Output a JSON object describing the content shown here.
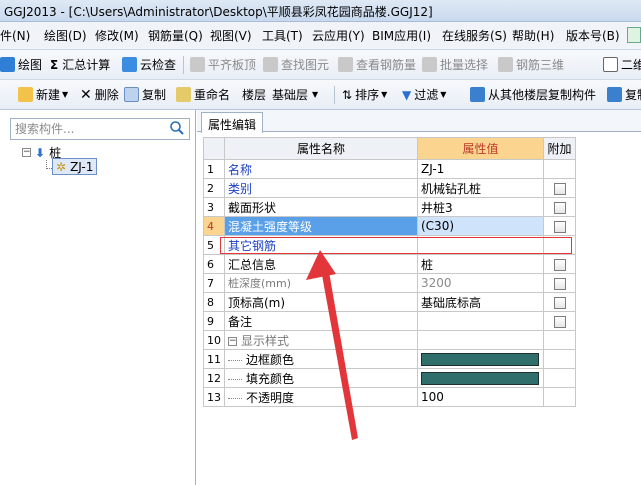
{
  "window": {
    "title": "GGJ2013 - [C:\\Users\\Administrator\\Desktop\\平顺县彩凤花园商品楼.GGJ12]"
  },
  "menu": [
    {
      "label": "件(N)"
    },
    {
      "label": "绘图(D)"
    },
    {
      "label": "修改(M)"
    },
    {
      "label": "钢筋量(Q)"
    },
    {
      "label": "视图(V)"
    },
    {
      "label": "工具(T)"
    },
    {
      "label": "云应用(Y)"
    },
    {
      "label": "BIM应用(I)"
    },
    {
      "label": "在线服务(S)"
    },
    {
      "label": "帮助(H)"
    },
    {
      "label": "版本号(B)"
    }
  ],
  "toolbar1": {
    "draw": "绘图",
    "summary": "汇总计算",
    "cloud_check": "云检查",
    "flat_slab": "平齐板顶",
    "find_element": "查找图元",
    "view_rebar": "查看钢筋量",
    "batch_select": "批量选择",
    "rebar_3d": "钢筋三维",
    "two_d": "二维"
  },
  "toolbar2": {
    "new": "新建",
    "delete": "删除",
    "copy": "复制",
    "rename": "重命名",
    "floor_label": "楼层",
    "floor_value": "基础层",
    "sort": "排序",
    "filter": "过滤",
    "copy_from_floor": "从其他楼层复制构件",
    "copy2": "复制"
  },
  "left_panel": {
    "search_placeholder": "搜索构件...",
    "tree_root": "桩",
    "tree_child": "ZJ-1"
  },
  "tab": "属性编辑",
  "grid": {
    "headers": {
      "name": "属性名称",
      "value": "属性值",
      "extra": "附加"
    },
    "rows": [
      {
        "num": "1",
        "name": "名称",
        "value": "ZJ-1",
        "checkbox": false
      },
      {
        "num": "2",
        "name": "类别",
        "value": "机械钻孔桩",
        "checkbox": true
      },
      {
        "num": "3",
        "name": "截面形状",
        "value": "井桩3",
        "checkbox": true
      },
      {
        "num": "4",
        "name": "混凝土强度等级",
        "value": "(C30)",
        "checkbox": true
      },
      {
        "num": "5",
        "name": "其它钢筋",
        "value": "",
        "checkbox": false
      },
      {
        "num": "6",
        "name": "汇总信息",
        "value": "桩",
        "checkbox": true
      },
      {
        "num": "7",
        "name": "桩深度(mm)",
        "value": "3200",
        "checkbox": true
      },
      {
        "num": "8",
        "name": "顶标高(m)",
        "value": "基础底标高",
        "checkbox": true
      },
      {
        "num": "9",
        "name": "备注",
        "value": "",
        "checkbox": true
      },
      {
        "num": "10",
        "name": "显示样式",
        "value": "",
        "checkbox": false
      },
      {
        "num": "11",
        "name": "边框颜色",
        "value": "",
        "checkbox": false
      },
      {
        "num": "12",
        "name": "填充颜色",
        "value": "",
        "checkbox": false
      },
      {
        "num": "13",
        "name": "不透明度",
        "value": "100",
        "checkbox": false
      }
    ]
  },
  "colors": {
    "accent": "#fbd58f",
    "selected": "#5aa0e8",
    "swatch": "#2f6e6a",
    "annotation": "#e2363a"
  }
}
